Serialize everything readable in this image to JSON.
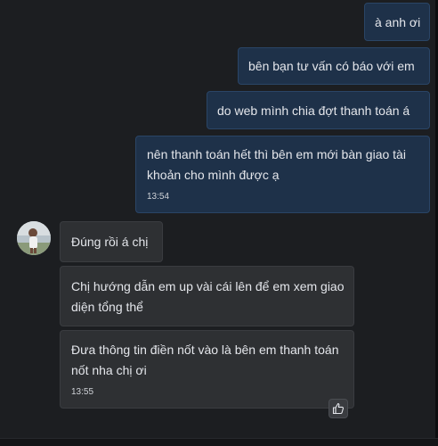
{
  "messages_out": [
    {
      "text": "à anh ơi"
    },
    {
      "text": "bên bạn tư vấn có báo với em"
    },
    {
      "text": "do web mình chia đợt thanh toán á"
    },
    {
      "text": "nên thanh toán hết thì bên em mới bàn giao tài khoản cho mình được ạ",
      "time": "13:54"
    }
  ],
  "messages_in": [
    {
      "text": "Đúng rồi á chị"
    },
    {
      "text": "Chị hướng dẫn em up vài cái lên để em xem giao diện tổng thể"
    },
    {
      "text": "Đưa thông tin điền nốt vào là bên em thanh toán nốt nha chị ơi",
      "time": "13:55"
    }
  ],
  "contact": {
    "avatar_icon": "contact-avatar"
  },
  "reaction": {
    "icon": "thumbs-up-icon"
  },
  "colors": {
    "background": "#1c1e21",
    "outgoing_bubble": "#1e3149",
    "incoming_bubble": "#2e3033",
    "text": "#e4e6eb"
  }
}
